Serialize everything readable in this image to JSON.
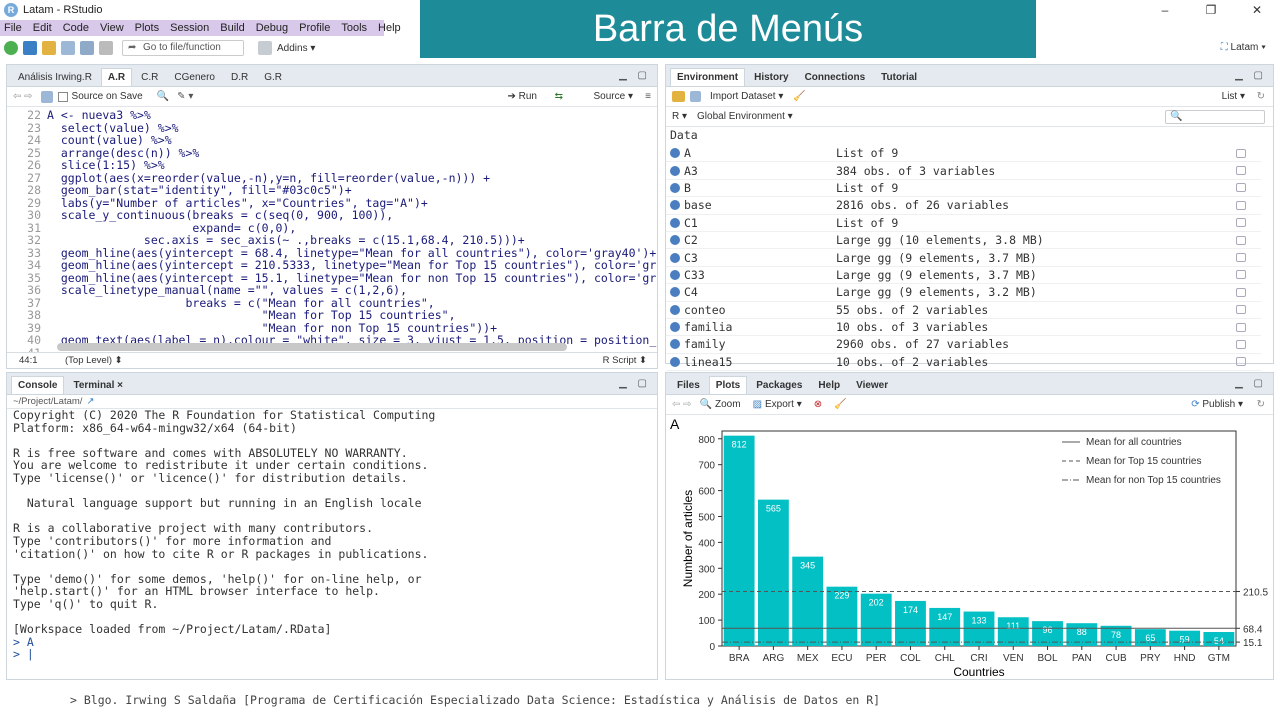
{
  "window": {
    "title": "Latam - RStudio",
    "controls": [
      "–",
      "❐",
      "✕"
    ]
  },
  "menu": [
    "File",
    "Edit",
    "Code",
    "View",
    "Plots",
    "Session",
    "Build",
    "Debug",
    "Profile",
    "Tools",
    "Help"
  ],
  "banner": "Barra de Menús",
  "toolbar": {
    "goto_placeholder": "Go to file/function",
    "addins": "Addins ▾",
    "project": "Latam ▾"
  },
  "editor": {
    "tabs": [
      "Análisis Irwing.R",
      "A.R",
      "C.R",
      "CGenero",
      "D.R",
      "G.R"
    ],
    "source_on_save": "Source on Save",
    "run": "➔ Run",
    "source": "Source ▾",
    "lines": [
      {
        "n": "22",
        "t": "A <- nueva3 %>%"
      },
      {
        "n": "23",
        "t": "  select(value) %>%"
      },
      {
        "n": "24",
        "t": "  count(value) %>%"
      },
      {
        "n": "25",
        "t": "  arrange(desc(n)) %>%"
      },
      {
        "n": "26",
        "t": "  slice(1:15) %>%"
      },
      {
        "n": "27",
        "t": "  ggplot(aes(x=reorder(value,-n),y=n, fill=reorder(value,-n))) +"
      },
      {
        "n": "28",
        "t": "  geom_bar(stat=\"identity\", fill=\"#03c0c5\")+"
      },
      {
        "n": "29",
        "t": "  labs(y=\"Number of articles\", x=\"Countries\", tag=\"A\")+"
      },
      {
        "n": "30",
        "t": "  scale_y_continuous(breaks = c(seq(0, 900, 100)),"
      },
      {
        "n": "31",
        "t": "                     expand= c(0,0),"
      },
      {
        "n": "32",
        "t": "              sec.axis = sec_axis(~ .,breaks = c(15.1,68.4, 210.5)))+"
      },
      {
        "n": "33",
        "t": "  geom_hline(aes(yintercept = 68.4, linetype=\"Mean for all countries\"), color='gray40')+"
      },
      {
        "n": "34",
        "t": "  geom_hline(aes(yintercept = 210.5333, linetype=\"Mean for Top 15 countries\"), color='gr"
      },
      {
        "n": "35",
        "t": "  geom_hline(aes(yintercept = 15.1, linetype=\"Mean for non Top 15 countries\"), color='gr"
      },
      {
        "n": "36",
        "t": "  scale_linetype_manual(name =\"\", values = c(1,2,6),"
      },
      {
        "n": "37",
        "t": "                    breaks = c(\"Mean for all countries\","
      },
      {
        "n": "38",
        "t": "                               \"Mean for Top 15 countries\","
      },
      {
        "n": "39",
        "t": "                               \"Mean for non Top 15 countries\"))+"
      },
      {
        "n": "40",
        "t": "  geom_text(aes(label = n),colour = \"white\", size = 3, vjust = 1.5, position = position_"
      },
      {
        "n": "41",
        "t": ""
      }
    ],
    "status_pos": "44:1",
    "status_scope": "(Top Level) ⬍",
    "status_type": "R Script ⬍"
  },
  "console": {
    "tabs": [
      "Console",
      "Terminal ×"
    ],
    "path": "~/Project/Latam/",
    "text": "Copyright (C) 2020 The R Foundation for Statistical Computing\nPlatform: x86_64-w64-mingw32/x64 (64-bit)\n\nR is free software and comes with ABSOLUTELY NO WARRANTY.\nYou are welcome to redistribute it under certain conditions.\nType 'license()' or 'licence()' for distribution details.\n\n  Natural language support but running in an English locale\n\nR is a collaborative project with many contributors.\nType 'contributors()' for more information and\n'citation()' on how to cite R or R packages in publications.\n\nType 'demo()' for some demos, 'help()' for on-line help, or\n'help.start()' for an HTML browser interface to help.\nType 'q()' to quit R.\n\n[Workspace loaded from ~/Project/Latam/.RData]\n",
    "prompt1": "> A",
    "prompt2": "> |"
  },
  "environment": {
    "tabs": [
      "Environment",
      "History",
      "Connections",
      "Tutorial"
    ],
    "import": "Import Dataset ▾",
    "list_mode": "List ▾",
    "lang": "R ▾",
    "scope": "Global Environment ▾",
    "section": "Data",
    "rows": [
      {
        "name": "A",
        "value": "List of  9"
      },
      {
        "name": "A3",
        "value": "384 obs. of 3 variables"
      },
      {
        "name": "B",
        "value": "List of  9"
      },
      {
        "name": "base",
        "value": "2816 obs. of 26 variables"
      },
      {
        "name": "C1",
        "value": "List of  9"
      },
      {
        "name": "C2",
        "value": "Large gg (10 elements,  3.8 MB)"
      },
      {
        "name": "C3",
        "value": "Large gg (9 elements,  3.7 MB)"
      },
      {
        "name": "C33",
        "value": "Large gg (9 elements,  3.7 MB)"
      },
      {
        "name": "C4",
        "value": "Large gg (9 elements,  3.2 MB)"
      },
      {
        "name": "conteo",
        "value": "55 obs. of 2 variables"
      },
      {
        "name": "familia",
        "value": "10 obs. of 3 variables"
      },
      {
        "name": "family",
        "value": "2960 obs. of 27 variables"
      },
      {
        "name": "linea15",
        "value": "10 obs. of 2 variables"
      }
    ]
  },
  "plots": {
    "tabs": [
      "Files",
      "Plots",
      "Packages",
      "Help",
      "Viewer"
    ],
    "zoom": "Zoom",
    "export": "Export ▾",
    "publish": "Publish ▾"
  },
  "chart_data": {
    "type": "bar",
    "tag": "A",
    "categories": [
      "BRA",
      "ARG",
      "MEX",
      "ECU",
      "PER",
      "COL",
      "CHL",
      "CRI",
      "VEN",
      "BOL",
      "PAN",
      "CUB",
      "PRY",
      "HND",
      "GTM"
    ],
    "values": [
      812,
      565,
      345,
      229,
      202,
      174,
      147,
      133,
      111,
      96,
      88,
      78,
      65,
      59,
      54
    ],
    "xlabel": "Countries",
    "ylabel": "Number of articles",
    "ylim": [
      0,
      830
    ],
    "yticks": [
      0,
      100,
      200,
      300,
      400,
      500,
      600,
      700,
      800
    ],
    "sec_ticks": [
      15.1,
      68.4,
      210.5
    ],
    "hlines": [
      {
        "name": "Mean for all countries",
        "value": 68.4,
        "dash": "solid"
      },
      {
        "name": "Mean for Top 15 countries",
        "value": 210.5333,
        "dash": "dashed"
      },
      {
        "name": "Mean for non Top 15 countries",
        "value": 15.1,
        "dash": "dashdot"
      }
    ],
    "bar_color": "#03c0c5"
  },
  "caption": "> Blgo. Irwing S Saldaña [Programa de Certificación Especializado Data Science: Estadística y Análisis de Datos en R]"
}
